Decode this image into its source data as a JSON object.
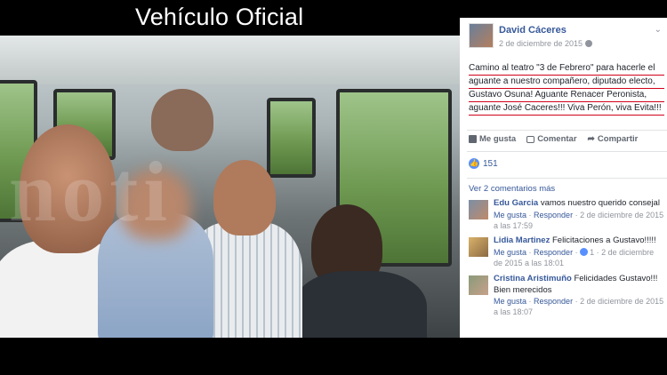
{
  "overlay": {
    "title": "Vehículo Oficial"
  },
  "photo": {
    "watermark": "noti"
  },
  "post": {
    "author": "David Cáceres",
    "date": "2 de diciembre de 2015",
    "text_lines": [
      "Camino al teatro \"3 de Febrero\" para hacerle el",
      "aguante a nuestro compañero, diputado electo,",
      "Gustavo Osuna! Aguante Renacer Peronista,",
      "aguante José Caceres!!! Viva Perón, viva Evita!!!"
    ],
    "actions": {
      "like": "Me gusta",
      "comment": "Comentar",
      "share": "Compartir"
    },
    "like_count": "151",
    "more_comments": "Ver 2 comentarios más",
    "accent_color": "#365899",
    "underline_color": "#d0021b"
  },
  "comments": [
    {
      "name": "Edu Garcia",
      "text": "vamos nuestro querido consejal",
      "like": "Me gusta",
      "reply": "Responder",
      "date": "2 de diciembre de 2015 a las 17:59",
      "likes": ""
    },
    {
      "name": "Lidia Martinez",
      "text": "Felicitaciones a Gustavo!!!!!",
      "like": "Me gusta",
      "reply": "Responder",
      "date": "2 de diciembre de 2015 a las 18:01",
      "likes": "1"
    },
    {
      "name": "Cristina Aristimuño",
      "text": "Felicidades Gustavo!!! Bien merecidos",
      "like": "Me gusta",
      "reply": "Responder",
      "date": "2 de diciembre de 2015 a las 18:07",
      "likes": ""
    }
  ]
}
